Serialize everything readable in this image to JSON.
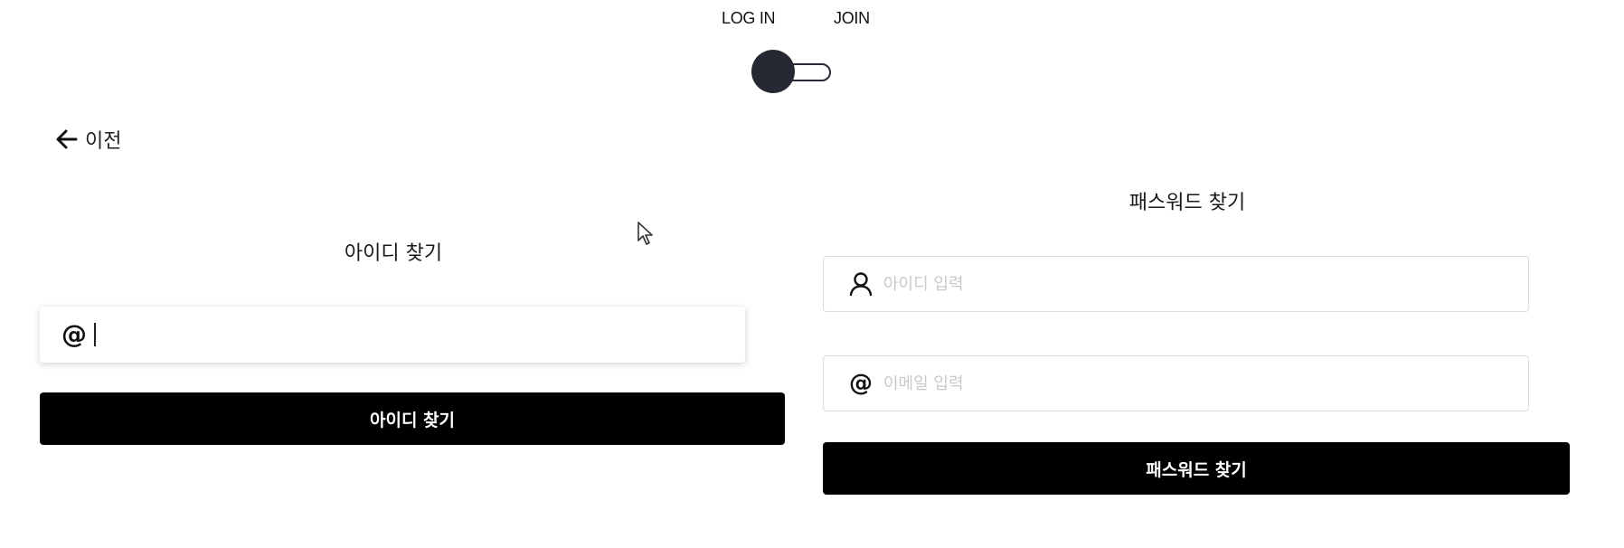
{
  "auth_switch": {
    "login_label": "LOG IN",
    "join_label": "JOIN",
    "selected": "LOG IN"
  },
  "back": {
    "icon": "arrow-left-icon",
    "label": "이전"
  },
  "find_id": {
    "title": "아이디 찾기",
    "email_input": {
      "icon": "at-icon",
      "value": "",
      "placeholder": ""
    },
    "submit_label": "아이디 찾기"
  },
  "find_password": {
    "title": "패스워드 찾기",
    "id_input": {
      "icon": "user-icon",
      "value": "",
      "placeholder": "아이디 입력"
    },
    "email_input": {
      "icon": "at-icon",
      "value": "",
      "placeholder": "이메일 입력"
    },
    "submit_label": "패스워드 찾기"
  },
  "colors": {
    "primary": "#000000",
    "toggle_knob": "#262833",
    "field_border": "#dcdcdc",
    "placeholder": "#c9c9c9"
  }
}
